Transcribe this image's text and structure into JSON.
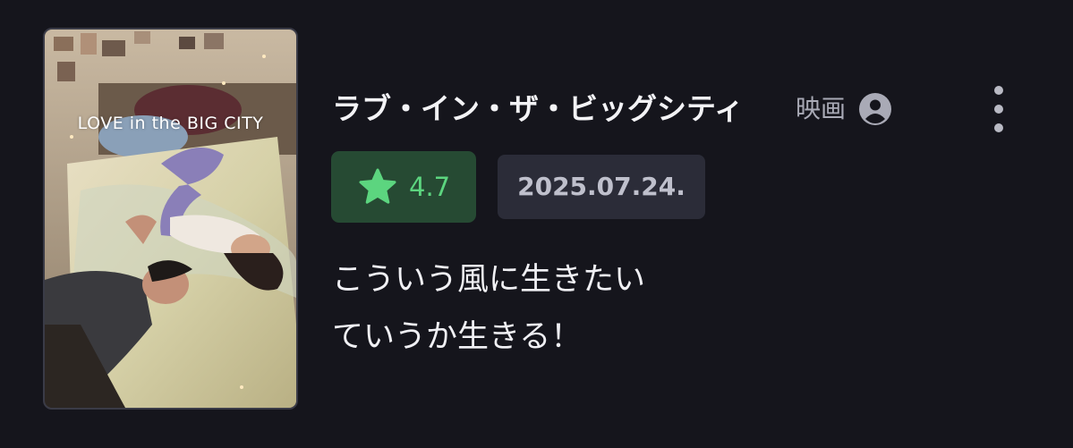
{
  "poster": {
    "title_art": "LOVE in the BIG CITY",
    "alt": "poster-image"
  },
  "item": {
    "title": "ラブ・イン・ザ・ビッグシティ",
    "type": "映画",
    "rating": "4.7",
    "date": "2025.07.24."
  },
  "comment": {
    "line1": "こういう風に生きたい",
    "line2": "ていうか生きる！"
  },
  "icons": {
    "user": "user-circle-icon",
    "more": "more-vertical-icon",
    "star": "star-icon"
  },
  "colors": {
    "background": "#15151c",
    "rating_bg": "#264a33",
    "rating_fg": "#5cd57f",
    "date_bg": "#2b2c38",
    "date_fg": "#bfc0cc"
  }
}
